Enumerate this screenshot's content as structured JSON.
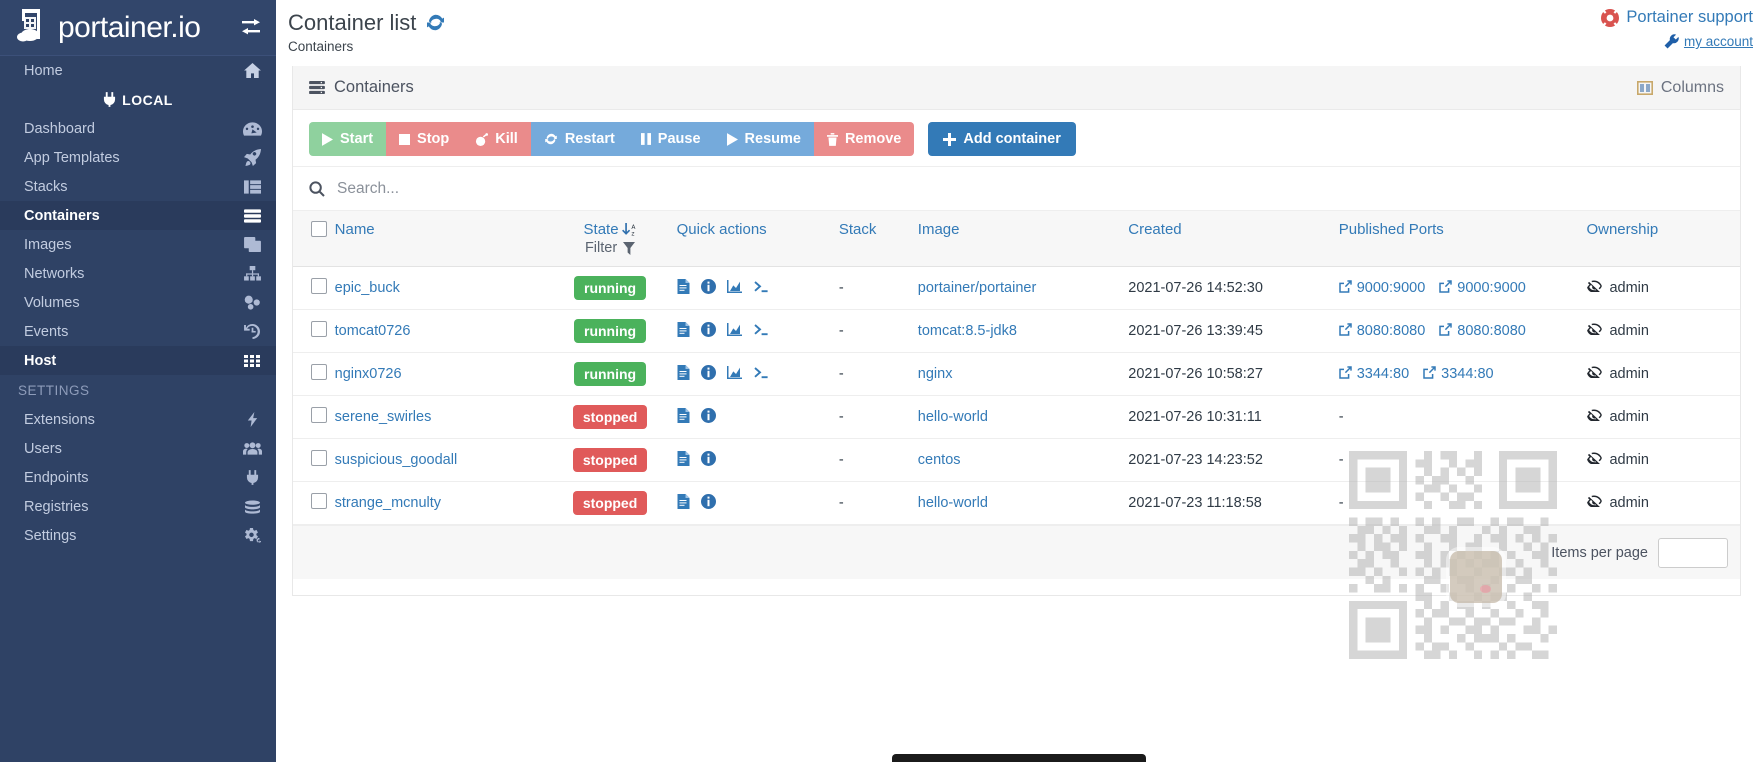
{
  "sidebar": {
    "brand": "portainer.io",
    "toggle_icon": "collapse-arrows-icon",
    "home": {
      "label": "Home",
      "icon": "home-icon"
    },
    "local_label": "LOCAL",
    "items": [
      {
        "label": "Dashboard",
        "icon": "dashboard-icon",
        "active": false
      },
      {
        "label": "App Templates",
        "icon": "rocket-icon",
        "active": false
      },
      {
        "label": "Stacks",
        "icon": "stacks-icon",
        "active": false
      },
      {
        "label": "Containers",
        "icon": "containers-icon",
        "active": true
      },
      {
        "label": "Images",
        "icon": "images-icon",
        "active": false
      },
      {
        "label": "Networks",
        "icon": "networks-icon",
        "active": false
      },
      {
        "label": "Volumes",
        "icon": "volumes-icon",
        "active": false
      },
      {
        "label": "Events",
        "icon": "history-icon",
        "active": false
      },
      {
        "label": "Host",
        "icon": "grid-icon",
        "active": true
      }
    ],
    "settings_section": "SETTINGS",
    "settings_items": [
      {
        "label": "Extensions",
        "icon": "bolt-icon"
      },
      {
        "label": "Users",
        "icon": "users-icon"
      },
      {
        "label": "Endpoints",
        "icon": "plug-icon"
      },
      {
        "label": "Registries",
        "icon": "database-icon"
      },
      {
        "label": "Settings",
        "icon": "gears-icon"
      }
    ]
  },
  "header": {
    "title": "Container list",
    "refresh_icon": "refresh-icon",
    "breadcrumb": "Containers",
    "support_label": "Portainer support",
    "support_icon": "lifering-icon",
    "account_label": "my account",
    "account_icon": "wrench-icon"
  },
  "panel": {
    "title": "Containers",
    "title_icon": "containers-icon",
    "columns_label": "Columns",
    "columns_icon": "columns-icon"
  },
  "toolbar": {
    "buttons": [
      {
        "label": "Start",
        "icon": "play-icon",
        "color": "green"
      },
      {
        "label": "Stop",
        "icon": "stop-icon",
        "color": "red"
      },
      {
        "label": "Kill",
        "icon": "bomb-icon",
        "color": "red"
      },
      {
        "label": "Restart",
        "icon": "restart-icon",
        "color": "blue"
      },
      {
        "label": "Pause",
        "icon": "pause-icon",
        "color": "blue"
      },
      {
        "label": "Resume",
        "icon": "play-icon",
        "color": "blue"
      },
      {
        "label": "Remove",
        "icon": "trash-icon",
        "color": "red"
      }
    ],
    "add_container": {
      "label": "Add container",
      "icon": "plus-icon"
    }
  },
  "search": {
    "placeholder": "Search...",
    "value": "",
    "icon": "search-icon"
  },
  "table": {
    "columns": {
      "name": "Name",
      "state": "State",
      "state_filter": "Filter",
      "quick_actions": "Quick actions",
      "stack": "Stack",
      "image": "Image",
      "created": "Created",
      "ports": "Published Ports",
      "ownership": "Ownership"
    },
    "sort_icon": "sort-alpha-down-icon",
    "filter_icon": "funnel-icon",
    "rows": [
      {
        "name": "epic_buck",
        "state": "running",
        "quick_actions": [
          "logs-icon",
          "info-icon",
          "stats-icon",
          "console-icon"
        ],
        "stack": "-",
        "image": "portainer/portainer",
        "created": "2021-07-26 14:52:30",
        "ports": [
          "9000:9000",
          "9000:9000"
        ],
        "ownership": "admin"
      },
      {
        "name": "tomcat0726",
        "state": "running",
        "quick_actions": [
          "logs-icon",
          "info-icon",
          "stats-icon",
          "console-icon"
        ],
        "stack": "-",
        "image": "tomcat:8.5-jdk8",
        "created": "2021-07-26 13:39:45",
        "ports": [
          "8080:8080",
          "8080:8080"
        ],
        "ownership": "admin"
      },
      {
        "name": "nginx0726",
        "state": "running",
        "quick_actions": [
          "logs-icon",
          "info-icon",
          "stats-icon",
          "console-icon"
        ],
        "stack": "-",
        "image": "nginx",
        "created": "2021-07-26 10:58:27",
        "ports": [
          "3344:80",
          "3344:80"
        ],
        "ownership": "admin"
      },
      {
        "name": "serene_swirles",
        "state": "stopped",
        "quick_actions": [
          "logs-icon",
          "info-icon"
        ],
        "stack": "-",
        "image": "hello-world",
        "created": "2021-07-26 10:31:11",
        "ports": [],
        "ports_empty": "-",
        "ownership": "admin"
      },
      {
        "name": "suspicious_goodall",
        "state": "stopped",
        "quick_actions": [
          "logs-icon",
          "info-icon"
        ],
        "stack": "-",
        "image": "centos",
        "created": "2021-07-23 14:23:52",
        "ports": [],
        "ports_empty": "-",
        "ownership": "admin"
      },
      {
        "name": "strange_mcnulty",
        "state": "stopped",
        "quick_actions": [
          "logs-icon",
          "info-icon"
        ],
        "stack": "-",
        "image": "hello-world",
        "created": "2021-07-23 11:18:58",
        "ports": [],
        "ports_empty": "-",
        "ownership": "admin"
      }
    ],
    "ownership_icon": "eye-slash-icon",
    "port_icon": "external-link-icon"
  },
  "footer": {
    "items_per_page_label": "Items per page"
  },
  "colors": {
    "sidebar_bg": "#2f4265",
    "link": "#337ab7",
    "running": "#4bb25c",
    "stopped": "#e05a5a",
    "btn_green": "#8fd19e",
    "btn_red": "#ea8b8b",
    "btn_blue": "#75aadb",
    "primary": "#337ab7"
  },
  "overlay": {
    "qr_watermark": "qr-code-icon"
  }
}
